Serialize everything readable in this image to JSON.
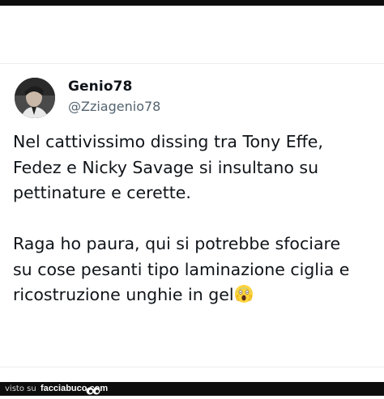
{
  "tweet": {
    "display_name": "Genio78",
    "handle": "@Zziagenio78",
    "text": "Nel cattivissimo dissing tra Tony Effe,\nFedez e Nicky Savage si insultano su\npettinature e cerette.\n\nRaga ho paura, qui si potrebbe sfociare\nsu cose pesanti tipo laminazione ciglia e\nricostruzione unghie in gel",
    "emoji": "screaming-face-emoji"
  },
  "footer": {
    "visto_su": "visto su",
    "site": "facciabuco.com",
    "logo_icon": "eyes-logo-icon"
  },
  "colors": {
    "text": "#0f1419",
    "handle": "#536471",
    "bar": "#0d0d0d"
  }
}
